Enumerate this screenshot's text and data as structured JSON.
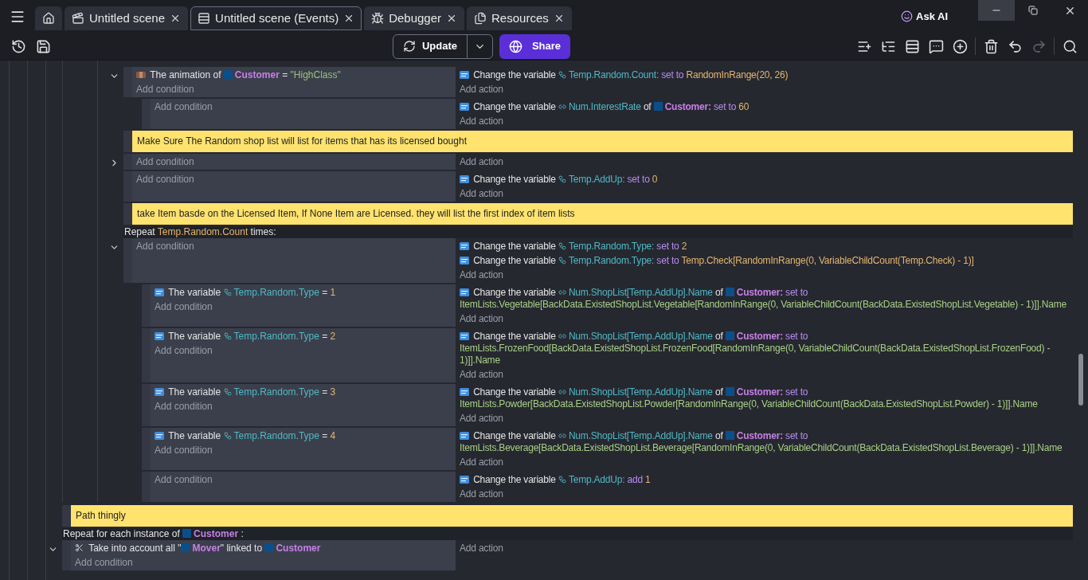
{
  "tabs": [
    {
      "kind": "home",
      "selected": false
    },
    {
      "kind": "scene",
      "label": "Untitled scene",
      "selected": false
    },
    {
      "kind": "events",
      "label": "Untitled scene (Events)",
      "selected": true
    },
    {
      "kind": "debugger",
      "label": "Debugger",
      "selected": false
    },
    {
      "kind": "resources",
      "label": "Resources",
      "selected": false
    }
  ],
  "ask_ai": "Ask AI",
  "toolbar": {
    "update": "Update",
    "share": "Share",
    "redo_disabled": true
  },
  "upper_events": [
    {
      "kind": "event",
      "expanded": true,
      "conditions": [
        {
          "kind": "animation",
          "tokens": [
            {
              "kind": "text",
              "s": "The animation of"
            },
            {
              "kind": "obj",
              "s": "Customer"
            },
            {
              "kind": "text",
              "s": "="
            },
            {
              "kind": "str",
              "s": "\"HighClass\""
            }
          ]
        }
      ],
      "actions": [
        {
          "kind": "variable",
          "tokens": [
            {
              "kind": "text",
              "s": "Change the variable"
            },
            {
              "kind": "svar",
              "s": "Temp.Random.Count:"
            },
            {
              "kind": "kw",
              "s": "set to"
            },
            {
              "kind": "num",
              "s": "RandomInRange(20, 26)"
            }
          ]
        }
      ],
      "add_condition": "Add condition",
      "add_action": "Add action",
      "children": [
        {
          "kind": "event",
          "actions": [
            {
              "kind": "variable",
              "tokens": [
                {
                  "kind": "text",
                  "s": "Change the variable"
                },
                {
                  "kind": "ovar",
                  "s": "Num.InterestRate"
                },
                {
                  "kind": "text",
                  "s": "of"
                },
                {
                  "kind": "obj",
                  "s": "Customer:"
                },
                {
                  "kind": "kw",
                  "s": "set to"
                },
                {
                  "kind": "num",
                  "s": "60"
                }
              ]
            }
          ],
          "add_condition": "Add condition",
          "add_action": "Add action"
        }
      ]
    },
    {
      "kind": "comment",
      "text": "Make Sure The Random shop list will list for items that has its licensed bought"
    },
    {
      "kind": "event",
      "expanded": false,
      "add_condition": "Add condition",
      "add_action": "Add action"
    },
    {
      "kind": "event",
      "actions": [
        {
          "kind": "variable",
          "tokens": [
            {
              "kind": "text",
              "s": "Change the variable"
            },
            {
              "kind": "svar",
              "s": "Temp.AddUp:"
            },
            {
              "kind": "kw",
              "s": "set to"
            },
            {
              "kind": "num",
              "s": "0"
            }
          ]
        }
      ],
      "add_condition": "Add condition",
      "add_action": "Add action"
    },
    {
      "kind": "comment",
      "text": "take Item basde on the Licensed Item, If None Item are Licensed. they will list the first index of item lists"
    },
    {
      "kind": "event",
      "expanded": true,
      "header": [
        {
          "kind": "text",
          "s": "Repeat"
        },
        {
          "kind": "num",
          "s": "Temp.Random.Count"
        },
        {
          "kind": "text",
          "s": "times:"
        }
      ],
      "actions": [
        {
          "kind": "variable",
          "tokens": [
            {
              "kind": "text",
              "s": "Change the variable"
            },
            {
              "kind": "svar",
              "s": "Temp.Random.Type:"
            },
            {
              "kind": "kw",
              "s": "set to"
            },
            {
              "kind": "num",
              "s": "2"
            }
          ]
        },
        {
          "kind": "variable",
          "tokens": [
            {
              "kind": "text",
              "s": "Change the variable"
            },
            {
              "kind": "svar",
              "s": "Temp.Random.Type:"
            },
            {
              "kind": "kw",
              "s": "set to"
            },
            {
              "kind": "num",
              "s": "Temp.Check[RandomInRange(0, VariableChildCount(Temp.Check) - 1)]"
            }
          ]
        }
      ],
      "add_condition": "Add condition",
      "add_action": "Add action",
      "children": [
        {
          "kind": "event",
          "conditions": [
            {
              "kind": "variable",
              "tokens": [
                {
                  "kind": "text",
                  "s": "The variable"
                },
                {
                  "kind": "svar",
                  "s": "Temp.Random.Type"
                },
                {
                  "kind": "text",
                  "s": "="
                },
                {
                  "kind": "num",
                  "s": "1"
                }
              ]
            }
          ],
          "actions": [
            {
              "kind": "variable",
              "tokens": [
                {
                  "kind": "text",
                  "s": "Change the variable"
                },
                {
                  "kind": "ovar",
                  "s": "Num.ShopList[Temp.AddUp].Name"
                },
                {
                  "kind": "text",
                  "s": "of"
                },
                {
                  "kind": "obj",
                  "s": "Customer:"
                },
                {
                  "kind": "kw",
                  "s": "set to"
                },
                {
                  "kind": "expr",
                  "s": "ItemLists.Vegetable[BackData.ExistedShopList.Vegetable[RandomInRange(0, VariableChildCount(BackData.ExistedShopList.Vegetable) - 1)]].Name"
                }
              ]
            }
          ],
          "add_condition": "Add condition",
          "add_action": "Add action"
        },
        {
          "kind": "event",
          "conditions": [
            {
              "kind": "variable",
              "tokens": [
                {
                  "kind": "text",
                  "s": "The variable"
                },
                {
                  "kind": "svar",
                  "s": "Temp.Random.Type"
                },
                {
                  "kind": "text",
                  "s": "="
                },
                {
                  "kind": "num",
                  "s": "2"
                }
              ]
            }
          ],
          "actions": [
            {
              "kind": "variable",
              "tokens": [
                {
                  "kind": "text",
                  "s": "Change the variable"
                },
                {
                  "kind": "ovar",
                  "s": "Num.ShopList[Temp.AddUp].Name"
                },
                {
                  "kind": "text",
                  "s": "of"
                },
                {
                  "kind": "obj",
                  "s": "Customer:"
                },
                {
                  "kind": "kw",
                  "s": "set to"
                },
                {
                  "kind": "expr",
                  "s": "ItemLists.FrozenFood[BackData.ExistedShopList.FrozenFood[RandomInRange(0, VariableChildCount(BackData.ExistedShopList.FrozenFood) - 1)]].Name"
                }
              ]
            }
          ],
          "add_condition": "Add condition",
          "add_action": "Add action"
        },
        {
          "kind": "event",
          "conditions": [
            {
              "kind": "variable",
              "tokens": [
                {
                  "kind": "text",
                  "s": "The variable"
                },
                {
                  "kind": "svar",
                  "s": "Temp.Random.Type"
                },
                {
                  "kind": "text",
                  "s": "="
                },
                {
                  "kind": "num",
                  "s": "3"
                }
              ]
            }
          ],
          "actions": [
            {
              "kind": "variable",
              "tokens": [
                {
                  "kind": "text",
                  "s": "Change the variable"
                },
                {
                  "kind": "ovar",
                  "s": "Num.ShopList[Temp.AddUp].Name"
                },
                {
                  "kind": "text",
                  "s": "of"
                },
                {
                  "kind": "obj",
                  "s": "Customer:"
                },
                {
                  "kind": "kw",
                  "s": "set to"
                },
                {
                  "kind": "expr",
                  "s": "ItemLists.Powder[BackData.ExistedShopList.Powder[RandomInRange(0, VariableChildCount(BackData.ExistedShopList.Powder) - 1)]].Name"
                }
              ]
            }
          ],
          "add_condition": "Add condition",
          "add_action": "Add action"
        },
        {
          "kind": "event",
          "conditions": [
            {
              "kind": "variable",
              "tokens": [
                {
                  "kind": "text",
                  "s": "The variable"
                },
                {
                  "kind": "svar",
                  "s": "Temp.Random.Type"
                },
                {
                  "kind": "text",
                  "s": "="
                },
                {
                  "kind": "num",
                  "s": "4"
                }
              ]
            }
          ],
          "actions": [
            {
              "kind": "variable",
              "tokens": [
                {
                  "kind": "text",
                  "s": "Change the variable"
                },
                {
                  "kind": "ovar",
                  "s": "Num.ShopList[Temp.AddUp].Name"
                },
                {
                  "kind": "text",
                  "s": "of"
                },
                {
                  "kind": "obj",
                  "s": "Customer:"
                },
                {
                  "kind": "kw",
                  "s": "set to"
                },
                {
                  "kind": "expr",
                  "s": "ItemLists.Beverage[BackData.ExistedShopList.Beverage[RandomInRange(0, VariableChildCount(BackData.ExistedShopList.Beverage) - 1)]].Name"
                }
              ]
            }
          ],
          "add_condition": "Add condition",
          "add_action": "Add action"
        },
        {
          "kind": "event",
          "actions": [
            {
              "kind": "variable",
              "tokens": [
                {
                  "kind": "text",
                  "s": "Change the variable"
                },
                {
                  "kind": "svar",
                  "s": "Temp.AddUp:"
                },
                {
                  "kind": "kw",
                  "s": "add"
                },
                {
                  "kind": "num",
                  "s": "1"
                }
              ]
            }
          ],
          "add_condition": "Add condition",
          "add_action": "Add action"
        }
      ]
    }
  ],
  "lower_events": [
    {
      "kind": "comment",
      "text": "Path thingly"
    },
    {
      "kind": "event",
      "expanded": true,
      "header": [
        {
          "kind": "text",
          "s": "Repeat for each instance of"
        },
        {
          "kind": "obj",
          "s": "Customer"
        },
        {
          "kind": "text",
          "s": ":"
        }
      ],
      "conditions": [
        {
          "kind": "link",
          "tokens": [
            {
              "kind": "text",
              "s": "Take into account all \""
            },
            {
              "kind": "obj",
              "s": "Mover",
              "glue": true
            },
            {
              "kind": "text",
              "s": "\" linked to",
              "glue": true
            },
            {
              "kind": "obj",
              "s": "Customer"
            }
          ]
        }
      ],
      "add_condition": "Add condition",
      "add_action": "Add action"
    }
  ]
}
